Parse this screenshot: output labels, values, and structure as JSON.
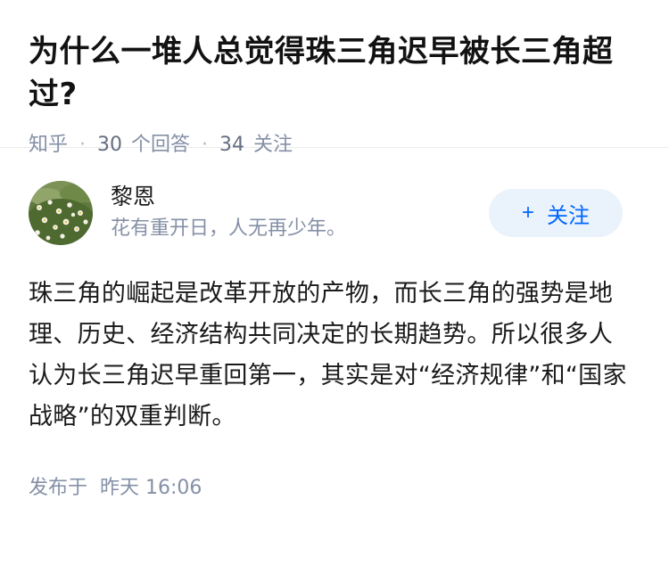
{
  "question": {
    "title": "为什么一堆人总觉得珠三角迟早被长三角超过?",
    "source": "知乎",
    "answer_count": "30",
    "answer_label": "个回答",
    "follower_count": "34",
    "follower_label": "关注"
  },
  "answer": {
    "author": {
      "name": "黎恩",
      "bio": "花有重开日，人无再少年。",
      "avatar_icon": "flower-field-avatar"
    },
    "follow_button": {
      "plus": "+",
      "label": "关注"
    },
    "content": "珠三角的崛起是改革开放的产物，而长三角的强势是地理、历史、经济结构共同决定的长期趋势。所以很多人认为长三角迟早重回第一，其实是对“经济规律”和“国家战略”的双重判断。",
    "time_label": "发布于",
    "time_value": "昨天 16:06"
  },
  "colors": {
    "accent": "#0066ff",
    "follow_bg": "#eaf2fb",
    "meta_text": "#8590a6"
  }
}
